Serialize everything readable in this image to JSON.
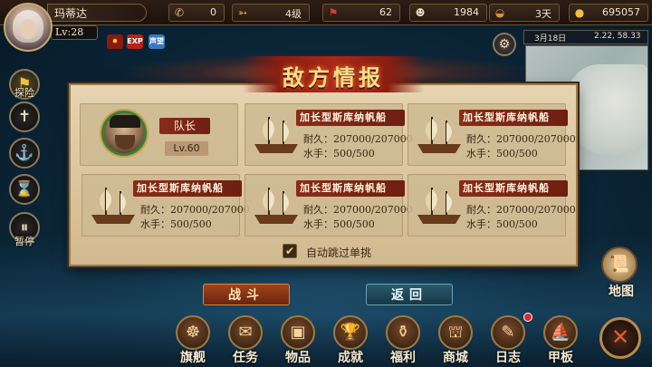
{
  "player": {
    "name": "玛蒂达",
    "level": "Lv:28"
  },
  "resources": [
    {
      "icon": "phone-icon",
      "value": "0"
    },
    {
      "icon": "arrow-icon",
      "value": "4级"
    },
    {
      "icon": "flag-icon",
      "value": "62"
    },
    {
      "icon": "sailor-icon",
      "value": "1984"
    },
    {
      "icon": "bread-icon",
      "value": "3天"
    },
    {
      "icon": "coin-icon",
      "value": "695057"
    }
  ],
  "badges": [
    "EXP",
    "声望"
  ],
  "side": {
    "explore": "探险",
    "pause": "暂停"
  },
  "minimap": {
    "date": "3月18日",
    "coords": "2.22, 58.33"
  },
  "panel": {
    "title": "敌方情报",
    "captain": {
      "label": "队长",
      "level": "Lv.60"
    },
    "ships": [
      {
        "name": "加长型斯库纳帆船",
        "durability": "耐久：207000/207000",
        "crew": "水手：500/500"
      },
      {
        "name": "加长型斯库纳帆船",
        "durability": "耐久：207000/207000",
        "crew": "水手：500/500"
      },
      {
        "name": "加长型斯库纳帆船",
        "durability": "耐久：207000/207000",
        "crew": "水手：500/500"
      },
      {
        "name": "加长型斯库纳帆船",
        "durability": "耐久：207000/207000",
        "crew": "水手：500/500"
      },
      {
        "name": "加长型斯库纳帆船",
        "durability": "耐久：207000/207000",
        "crew": "水手：500/500"
      }
    ],
    "auto_skip": "自动跳过单挑",
    "auto_skip_checked": true
  },
  "buttons": {
    "fight": "战斗",
    "back": "返回"
  },
  "map_button": "地图",
  "bottom_menu": [
    "旗舰",
    "任务",
    "物品",
    "成就",
    "福利",
    "商城",
    "日志",
    "甲板"
  ]
}
